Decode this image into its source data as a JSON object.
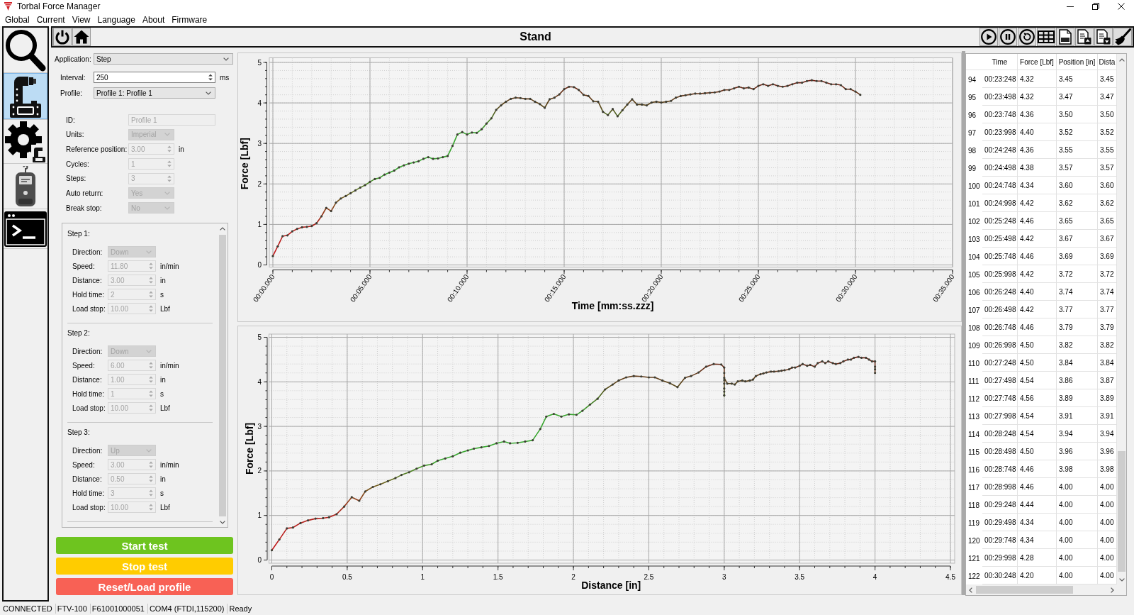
{
  "window": {
    "title": "Torbal Force Manager"
  },
  "menu": [
    "Global",
    "Current",
    "View",
    "Language",
    "About",
    "Firmware"
  ],
  "sidebar": {
    "items": [
      {
        "kind": "search",
        "selected": false
      },
      {
        "kind": "stand",
        "selected": true
      },
      {
        "kind": "settings",
        "selected": false
      },
      {
        "kind": "gauge",
        "selected": false
      },
      {
        "kind": "terminal",
        "selected": false
      }
    ]
  },
  "header": {
    "title": "Stand"
  },
  "settings": {
    "top_fields": [
      {
        "label": "Application:",
        "value": "Step",
        "kind": "combo",
        "disabled": false
      },
      {
        "label": "Interval:",
        "value": "250",
        "unit": "ms",
        "kind": "spin",
        "disabled": false
      },
      {
        "label": "Profile:",
        "value": "Profile 1: Profile 1",
        "kind": "combo",
        "disabled": false
      }
    ],
    "profile_fields": [
      {
        "label": "ID:",
        "value": "Profile 1",
        "kind": "text",
        "disabled": true
      },
      {
        "label": "Units:",
        "value": "Imperial",
        "kind": "combo",
        "disabled": true
      },
      {
        "label": "Reference position:",
        "value": "3.00",
        "unit": "in",
        "kind": "spin",
        "disabled": true
      },
      {
        "label": "Cycles:",
        "value": "1",
        "kind": "spin",
        "disabled": true
      },
      {
        "label": "Steps:",
        "value": "3",
        "kind": "spin",
        "disabled": true
      },
      {
        "label": "Auto return:",
        "value": "Yes",
        "kind": "combo",
        "disabled": true
      },
      {
        "label": "Break stop:",
        "value": "No",
        "kind": "combo",
        "disabled": true
      }
    ],
    "steps": [
      {
        "title": "Step 1:",
        "fields": [
          {
            "label": "Direction:",
            "value": "Down",
            "kind": "combo",
            "disabled": true
          },
          {
            "label": "Speed:",
            "value": "11.80",
            "unit": "in/min",
            "kind": "spin",
            "disabled": true
          },
          {
            "label": "Distance:",
            "value": "3.00",
            "unit": "in",
            "kind": "spin",
            "disabled": true
          },
          {
            "label": "Hold time:",
            "value": "2",
            "unit": "s",
            "kind": "spin",
            "disabled": true
          },
          {
            "label": "Load stop:",
            "value": "10.00",
            "unit": "Lbf",
            "kind": "spin",
            "disabled": true
          }
        ]
      },
      {
        "title": "Step 2:",
        "fields": [
          {
            "label": "Direction:",
            "value": "Down",
            "kind": "combo",
            "disabled": true
          },
          {
            "label": "Speed:",
            "value": "6.00",
            "unit": "in/min",
            "kind": "spin",
            "disabled": true
          },
          {
            "label": "Distance:",
            "value": "1.00",
            "unit": "in",
            "kind": "spin",
            "disabled": true
          },
          {
            "label": "Hold time:",
            "value": "1",
            "unit": "s",
            "kind": "spin",
            "disabled": true
          },
          {
            "label": "Load stop:",
            "value": "10.00",
            "unit": "Lbf",
            "kind": "spin",
            "disabled": true
          }
        ]
      },
      {
        "title": "Step 3:",
        "fields": [
          {
            "label": "Direction:",
            "value": "Up",
            "kind": "combo",
            "disabled": true
          },
          {
            "label": "Speed:",
            "value": "3.00",
            "unit": "in/min",
            "kind": "spin",
            "disabled": true
          },
          {
            "label": "Distance:",
            "value": "0.50",
            "unit": "in",
            "kind": "spin",
            "disabled": true
          },
          {
            "label": "Hold time:",
            "value": "3",
            "unit": "s",
            "kind": "spin",
            "disabled": true
          },
          {
            "label": "Load stop:",
            "value": "10.00",
            "unit": "Lbf",
            "kind": "spin",
            "disabled": true
          }
        ]
      }
    ]
  },
  "actions": [
    {
      "label": "Start test",
      "color": "#6ec41f"
    },
    {
      "label": "Stop test",
      "color": "#ffcc00"
    },
    {
      "label": "Reset/Load profile",
      "color": "#f86155"
    }
  ],
  "charts": [
    {
      "chart_data": {
        "type": "line",
        "xlabel": "Time [mm:ss.zzz]",
        "ylabel": "Force [Lbf]",
        "grid": true,
        "categories": [
          "00:00.000",
          null,
          null,
          null,
          null,
          null,
          null,
          null,
          null,
          null,
          null,
          null,
          null,
          null,
          null,
          null,
          null,
          null,
          null,
          null,
          "00:05.000",
          null,
          null,
          null,
          null,
          null,
          null,
          null,
          null,
          null,
          null,
          null,
          null,
          null,
          null,
          null,
          null,
          null,
          null,
          null,
          "00:10.000",
          null,
          null,
          null,
          null,
          null,
          null,
          null,
          null,
          null,
          null,
          null,
          null,
          null,
          null,
          null,
          null,
          null,
          null,
          null,
          "00:15.000",
          null,
          null,
          null,
          null,
          null,
          null,
          null,
          null,
          null,
          null,
          null,
          null,
          null,
          null,
          null,
          null,
          null,
          null,
          null,
          "00:20.000",
          null,
          null,
          null,
          null,
          null,
          null,
          null,
          null,
          null,
          null,
          null,
          null,
          null,
          null,
          null,
          null,
          null,
          null,
          null,
          "00:25.000",
          null,
          null,
          null,
          null,
          null,
          null,
          null,
          null,
          null,
          null,
          null,
          null,
          null,
          null,
          null,
          null,
          null,
          null,
          null,
          "00:30.000",
          null,
          null,
          null,
          null,
          null,
          null,
          null,
          null,
          null,
          null,
          null,
          null,
          null,
          null,
          null,
          null,
          null,
          null,
          null,
          "00:35.000"
        ],
        "series": [
          {
            "values": [
              0.22,
              0.46,
              0.71,
              0.73,
              0.83,
              0.89,
              0.93,
              0.94,
              0.96,
              1.03,
              1.2,
              1.41,
              1.33,
              1.54,
              1.64,
              1.7,
              1.77,
              1.84,
              1.91,
              1.97,
              2.05,
              2.12,
              2.15,
              2.23,
              2.28,
              2.33,
              2.41,
              2.46,
              2.5,
              2.53,
              2.56,
              2.62,
              2.66,
              2.62,
              2.63,
              2.66,
              2.69,
              2.94,
              3.22,
              3.28,
              3.22,
              3.27,
              3.26,
              3.35,
              3.49,
              3.62,
              3.83,
              3.94,
              4.03,
              4.1,
              4.13,
              4.12,
              4.1,
              4.1,
              4.03,
              3.97,
              3.88,
              4.09,
              4.13,
              4.21,
              4.34,
              4.4,
              4.39,
              4.32,
              4.2,
              4.17,
              4.04,
              4.03,
              3.78,
              3.7,
              3.85,
              3.67,
              3.82,
              3.96,
              4.09,
              3.96,
              3.96,
              3.94,
              4.01,
              4.03,
              4.01,
              4.03,
              4.05,
              4.13,
              4.17,
              4.19,
              4.21,
              4.23,
              4.23,
              4.24,
              4.25,
              4.26,
              4.28,
              4.32,
              4.32,
              4.36,
              4.4,
              4.36,
              4.38,
              4.34,
              4.42,
              4.46,
              4.42,
              4.46,
              4.42,
              4.4,
              4.42,
              4.46,
              4.5,
              4.5,
              4.54,
              4.56,
              4.54,
              4.54,
              4.5,
              4.46,
              4.46,
              4.44,
              4.34,
              4.34,
              4.28,
              4.2,
              null,
              null,
              null,
              null,
              null,
              null,
              null,
              null,
              null,
              null,
              null,
              null,
              null,
              null,
              null,
              null,
              null,
              null,
              null
            ]
          }
        ],
        "ylim": [
          0,
          5
        ],
        "yticks": [
          0,
          1,
          2,
          3,
          4,
          5
        ]
      }
    },
    {
      "chart_data": {
        "type": "line",
        "xlabel": "Distance [in]",
        "ylabel": "Force [Lbf]",
        "grid": true,
        "x": [
          0,
          0.05,
          0.1,
          0.14,
          0.19,
          0.24,
          0.29,
          0.34,
          0.38,
          0.43,
          0.48,
          0.53,
          0.58,
          0.62,
          0.67,
          0.72,
          0.77,
          0.82,
          0.86,
          0.91,
          0.96,
          1.01,
          1.06,
          1.1,
          1.15,
          1.2,
          1.25,
          1.3,
          1.34,
          1.39,
          1.44,
          1.49,
          1.54,
          1.58,
          1.63,
          1.68,
          1.73,
          1.78,
          1.82,
          1.87,
          1.92,
          1.97,
          2.02,
          2.06,
          2.11,
          2.16,
          2.21,
          2.26,
          2.3,
          2.35,
          2.4,
          2.45,
          2.5,
          2.54,
          2.59,
          2.64,
          2.69,
          2.74,
          2.78,
          2.83,
          2.88,
          2.93,
          2.98,
          3,
          3,
          3,
          3,
          3,
          3,
          3,
          3,
          3,
          3,
          3,
          3,
          3.02,
          3.05,
          3.07,
          3.09,
          3.12,
          3.14,
          3.17,
          3.19,
          3.21,
          3.24,
          3.26,
          3.28,
          3.31,
          3.33,
          3.36,
          3.38,
          3.4,
          3.43,
          3.45,
          3.47,
          3.5,
          3.52,
          3.55,
          3.57,
          3.6,
          3.62,
          3.65,
          3.67,
          3.69,
          3.72,
          3.74,
          3.77,
          3.79,
          3.82,
          3.84,
          3.86,
          3.89,
          3.91,
          3.94,
          3.96,
          3.98,
          4,
          4,
          4,
          4,
          4,
          4
        ],
        "series": [
          {
            "values": [
              0.22,
              0.46,
              0.71,
              0.73,
              0.83,
              0.89,
              0.93,
              0.94,
              0.96,
              1.03,
              1.2,
              1.41,
              1.33,
              1.54,
              1.64,
              1.7,
              1.77,
              1.84,
              1.91,
              1.97,
              2.05,
              2.12,
              2.15,
              2.23,
              2.28,
              2.33,
              2.41,
              2.46,
              2.5,
              2.53,
              2.56,
              2.62,
              2.66,
              2.62,
              2.63,
              2.66,
              2.69,
              2.94,
              3.22,
              3.28,
              3.22,
              3.27,
              3.26,
              3.35,
              3.49,
              3.62,
              3.83,
              3.94,
              4.03,
              4.1,
              4.13,
              4.12,
              4.1,
              4.1,
              4.03,
              3.97,
              3.88,
              4.09,
              4.13,
              4.21,
              4.34,
              4.4,
              4.39,
              4.32,
              4.2,
              4.17,
              4.04,
              4.03,
              3.78,
              3.7,
              3.85,
              3.67,
              3.82,
              3.96,
              4.09,
              3.96,
              3.96,
              3.94,
              4.01,
              4.03,
              4.01,
              4.03,
              4.05,
              4.13,
              4.17,
              4.19,
              4.21,
              4.23,
              4.23,
              4.24,
              4.25,
              4.26,
              4.28,
              4.32,
              4.32,
              4.36,
              4.4,
              4.36,
              4.38,
              4.34,
              4.42,
              4.46,
              4.42,
              4.46,
              4.42,
              4.4,
              4.42,
              4.46,
              4.5,
              4.5,
              4.54,
              4.56,
              4.54,
              4.54,
              4.5,
              4.46,
              4.46,
              4.44,
              4.34,
              4.34,
              4.28,
              4.2
            ]
          }
        ],
        "xlim": [
          0,
          4.5
        ],
        "ylim": [
          0,
          5
        ],
        "xticks": [
          0,
          0.5,
          1,
          1.5,
          2,
          2.5,
          3,
          3.5,
          4,
          4.5
        ],
        "yticks": [
          0,
          1,
          2,
          3,
          4,
          5
        ]
      }
    }
  ],
  "table": {
    "columns": [
      "Time",
      "Force [Lbf]",
      "Position [in]",
      "Dista"
    ],
    "rows": [
      {
        "index": "94",
        "cells": [
          "00:23:248",
          "4.32",
          "3.45",
          "3.45"
        ]
      },
      {
        "index": "95",
        "cells": [
          "00:23:498",
          "4.32",
          "3.47",
          "3.47"
        ]
      },
      {
        "index": "96",
        "cells": [
          "00:23:748",
          "4.36",
          "3.50",
          "3.50"
        ]
      },
      {
        "index": "97",
        "cells": [
          "00:23:998",
          "4.40",
          "3.52",
          "3.52"
        ]
      },
      {
        "index": "98",
        "cells": [
          "00:24:248",
          "4.36",
          "3.55",
          "3.55"
        ]
      },
      {
        "index": "99",
        "cells": [
          "00:24:498",
          "4.38",
          "3.57",
          "3.57"
        ]
      },
      {
        "index": "100",
        "cells": [
          "00:24:748",
          "4.34",
          "3.60",
          "3.60"
        ]
      },
      {
        "index": "101",
        "cells": [
          "00:24:998",
          "4.42",
          "3.62",
          "3.62"
        ]
      },
      {
        "index": "102",
        "cells": [
          "00:25:248",
          "4.46",
          "3.65",
          "3.65"
        ]
      },
      {
        "index": "103",
        "cells": [
          "00:25:498",
          "4.42",
          "3.67",
          "3.67"
        ]
      },
      {
        "index": "104",
        "cells": [
          "00:25:748",
          "4.46",
          "3.69",
          "3.69"
        ]
      },
      {
        "index": "105",
        "cells": [
          "00:25:998",
          "4.42",
          "3.72",
          "3.72"
        ]
      },
      {
        "index": "106",
        "cells": [
          "00:26:248",
          "4.40",
          "3.74",
          "3.74"
        ]
      },
      {
        "index": "107",
        "cells": [
          "00:26:498",
          "4.42",
          "3.77",
          "3.77"
        ]
      },
      {
        "index": "108",
        "cells": [
          "00:26:748",
          "4.46",
          "3.79",
          "3.79"
        ]
      },
      {
        "index": "109",
        "cells": [
          "00:26:998",
          "4.50",
          "3.82",
          "3.82"
        ]
      },
      {
        "index": "110",
        "cells": [
          "00:27:248",
          "4.50",
          "3.84",
          "3.84"
        ]
      },
      {
        "index": "111",
        "cells": [
          "00:27:498",
          "4.54",
          "3.86",
          "3.87"
        ]
      },
      {
        "index": "112",
        "cells": [
          "00:27:748",
          "4.56",
          "3.89",
          "3.89"
        ]
      },
      {
        "index": "113",
        "cells": [
          "00:27:998",
          "4.54",
          "3.91",
          "3.91"
        ]
      },
      {
        "index": "114",
        "cells": [
          "00:28:248",
          "4.54",
          "3.94",
          "3.94"
        ]
      },
      {
        "index": "115",
        "cells": [
          "00:28:498",
          "4.50",
          "3.96",
          "3.96"
        ]
      },
      {
        "index": "116",
        "cells": [
          "00:28:748",
          "4.46",
          "3.98",
          "3.98"
        ]
      },
      {
        "index": "117",
        "cells": [
          "00:28:998",
          "4.46",
          "4.00",
          "4.00"
        ]
      },
      {
        "index": "118",
        "cells": [
          "00:29:248",
          "4.44",
          "4.00",
          "4.00"
        ]
      },
      {
        "index": "119",
        "cells": [
          "00:29:498",
          "4.34",
          "4.00",
          "4.00"
        ]
      },
      {
        "index": "120",
        "cells": [
          "00:29:748",
          "4.34",
          "4.00",
          "4.00"
        ]
      },
      {
        "index": "121",
        "cells": [
          "00:29:998",
          "4.28",
          "4.00",
          "4.00"
        ]
      },
      {
        "index": "122",
        "cells": [
          "00:30:248",
          "4.20",
          "4.00",
          "4.00"
        ]
      }
    ]
  },
  "status_bar": [
    "CONNECTED",
    "FTV-100",
    "F61001000051",
    "COM4 (FTDI,115200)",
    "Ready"
  ]
}
